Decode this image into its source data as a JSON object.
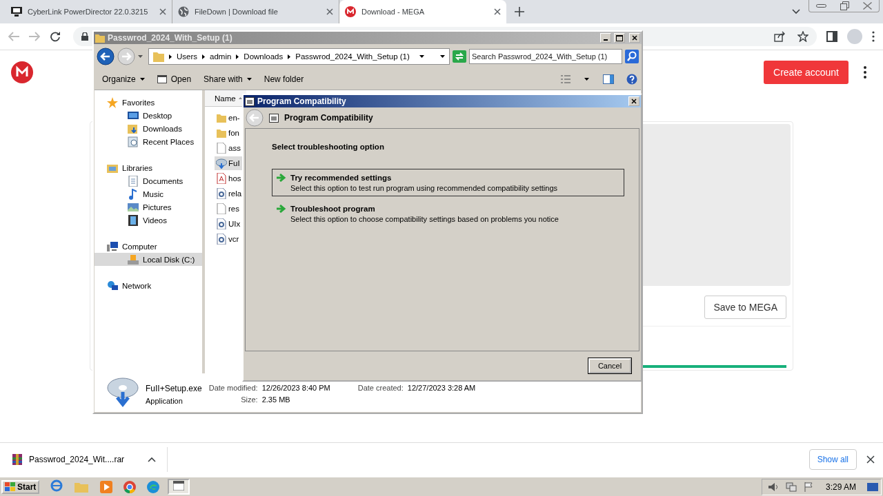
{
  "browser": {
    "tabs": [
      {
        "title": "CyberLink PowerDirector 22.0.3215",
        "kind": "app",
        "selected": false
      },
      {
        "title": "FileDown | Download file",
        "kind": "globe",
        "selected": false
      },
      {
        "title": "Download - MEGA",
        "kind": "mega",
        "selected": true
      }
    ]
  },
  "page": {
    "create_account": "Create account",
    "save_button": "Save to MEGA",
    "progress": {
      "level": 1
    }
  },
  "explorer": {
    "title": "Passwrod_2024_With_Setup (1)",
    "breadcrumb": [
      "Users",
      "admin",
      "Downloads",
      "Passwrod_2024_With_Setup (1)"
    ],
    "search": {
      "placeholder": "Search Passwrod_2024_With_Setup (1)"
    },
    "toolbar": [
      {
        "label": "Organize",
        "kind": "menu"
      },
      {
        "label": "Open",
        "kind": "open"
      },
      {
        "label": "Share with",
        "kind": "menu"
      },
      {
        "label": "New folder",
        "kind": "plain"
      }
    ],
    "nav": [
      {
        "label": "Favorites",
        "kind": "star",
        "selected": false,
        "children": [
          {
            "label": "Desktop",
            "kind": "desktop",
            "selected": false
          },
          {
            "label": "Downloads",
            "kind": "downloads",
            "selected": false
          },
          {
            "label": "Recent Places",
            "kind": "recent",
            "selected": false
          }
        ]
      },
      {
        "label": "Libraries",
        "kind": "library",
        "selected": false,
        "children": [
          {
            "label": "Documents",
            "kind": "document",
            "selected": false
          },
          {
            "label": "Music",
            "kind": "music",
            "selected": false
          },
          {
            "label": "Pictures",
            "kind": "picture",
            "selected": false
          },
          {
            "label": "Videos",
            "kind": "video",
            "selected": false
          }
        ]
      },
      {
        "label": "Computer",
        "kind": "computer",
        "selected": false,
        "children": [
          {
            "label": "Local Disk (C:)",
            "kind": "disk",
            "selected": true
          }
        ]
      },
      {
        "label": "Network",
        "kind": "network",
        "selected": false
      }
    ],
    "column": "Name",
    "files": [
      {
        "name": "en-",
        "kind": "folder",
        "selected": false
      },
      {
        "name": "fon",
        "kind": "folder",
        "selected": false
      },
      {
        "name": "ass",
        "kind": "file",
        "selected": false
      },
      {
        "name": "FuI",
        "kind": "exe",
        "selected": true
      },
      {
        "name": "hos",
        "kind": "pdf",
        "selected": false
      },
      {
        "name": "rela",
        "kind": "dll",
        "selected": false
      },
      {
        "name": "res",
        "kind": "file",
        "selected": false
      },
      {
        "name": "UIx",
        "kind": "dll",
        "selected": false
      },
      {
        "name": "vcr",
        "kind": "dll",
        "selected": false
      }
    ],
    "details": {
      "name": "FuII+Setup.exe",
      "type": "Application",
      "fields": [
        {
          "label": "Date modified:",
          "value": "12/26/2023 8:40 PM"
        },
        {
          "label": "Size:",
          "value": "2.35 MB"
        },
        {
          "label": "Date created:",
          "value": "12/27/2023 3:28 AM"
        }
      ]
    }
  },
  "dialog": {
    "title": "Program Compatibility",
    "heading": "Program Compatibility",
    "prompt": "Select troubleshooting option",
    "options": [
      {
        "title": "Try recommended settings",
        "description": "Select this option to test run program using recommended compatibility settings",
        "selected": true
      },
      {
        "title": "Troubleshoot program",
        "description": "Select this option to choose compatibility settings based on problems you notice",
        "selected": false
      }
    ],
    "cancel": "Cancel"
  },
  "downloads_bar": {
    "file": "Passwrod_2024_Wit....rar",
    "show_all": "Show all"
  },
  "taskbar": {
    "start": "Start",
    "clock": "3:29 AM"
  }
}
